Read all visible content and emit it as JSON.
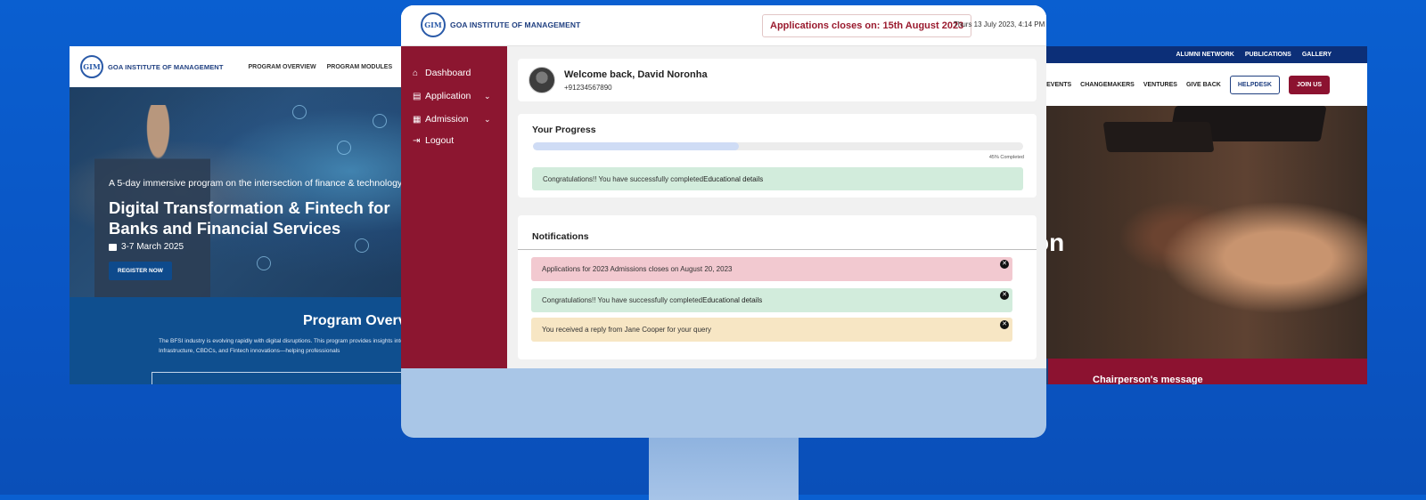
{
  "brand": {
    "logo_text": "GOA INSTITUTE OF MANAGEMENT",
    "logo_mark": "GIM"
  },
  "left_site": {
    "nav": [
      "PROGRAM OVERVIEW",
      "PROGRAM MODULES"
    ],
    "hero_sub": "A 5-day immersive program on the intersection of finance & technology",
    "hero_title": "Digital Transformation & Fintech for Banks and Financial Services",
    "hero_date": "3-7 March 2025",
    "register_label": "REGISTER NOW",
    "overview_title": "Program Overview",
    "overview_text": "The BFSI industry is evolving rapidly with digital disruptions. This program provides insights into Digital Public Infrastructure, CBDCs, and Fintech innovations—helping professionals"
  },
  "right_site": {
    "top_links": [
      "ALUMNI NETWORK",
      "PUBLICATIONS",
      "GALLERY"
    ],
    "nav": [
      "EVENTS",
      "CHANGEMAKERS",
      "VENTURES",
      "GIVE BACK"
    ],
    "helpdesk_label": "HELPDESK",
    "join_label": "JOIN US",
    "hero_partial": "on",
    "chairperson_label": "Chairperson's message"
  },
  "dashboard": {
    "deadline": "Applications closes on: 15th August 2023",
    "datetime": "Thurs 13 July 2023, 4:14 PM",
    "sidebar": [
      {
        "label": "Dashboard",
        "icon": "home-icon",
        "glyph": "⌂"
      },
      {
        "label": "Application",
        "icon": "document-icon",
        "glyph": "▤",
        "expandable": true
      },
      {
        "label": "Admission",
        "icon": "school-icon",
        "glyph": "▦",
        "expandable": true
      },
      {
        "label": "Logout",
        "icon": "logout-icon",
        "glyph": "⇥"
      }
    ],
    "welcome_name": "Welcome back, David Noronha",
    "phone": "+91234567890",
    "progress_title": "Your Progress",
    "progress_value": 0.42,
    "progress_label": "45% Completed",
    "progress_message_prefix": "Congratulations!! You have successfully completed ",
    "progress_message_strong": "Educational details",
    "notifications_title": "Notifications",
    "notifications": [
      {
        "text": "Applications for 2023 Admissions closes on August 20, 2023",
        "strong": "",
        "color": "#f2c9d0"
      },
      {
        "text": "Congratulations!! You have successfully completed ",
        "strong": "Educational details",
        "color": "#d2ecdc"
      },
      {
        "text": "You received a reply from Jane Cooper for your query",
        "strong": "",
        "color": "#f7e6c4"
      }
    ]
  }
}
